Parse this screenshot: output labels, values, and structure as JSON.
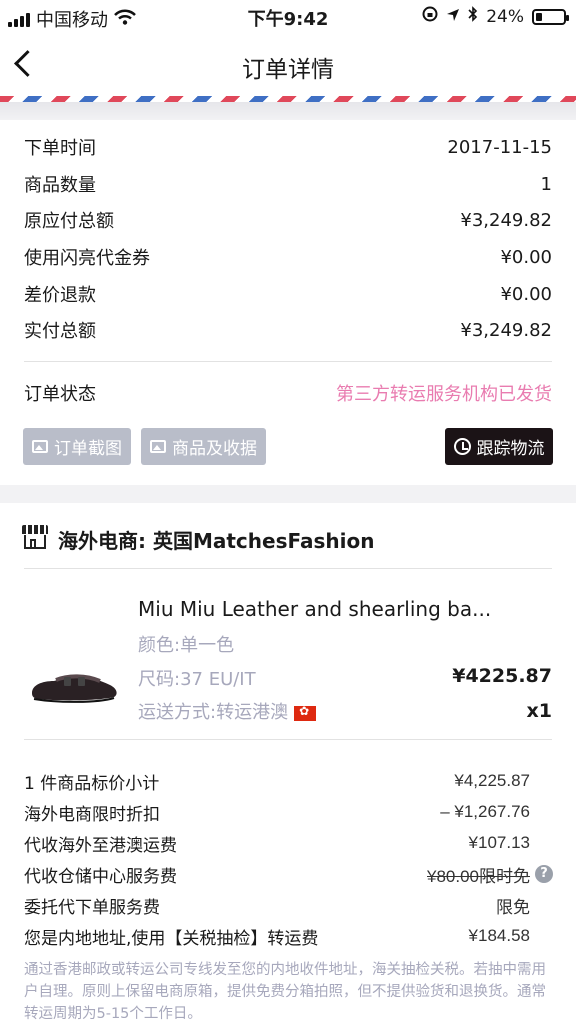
{
  "status_bar": {
    "carrier": "中国移动",
    "time": "下午9:42",
    "battery": "24%",
    "battery_level": 0.24
  },
  "nav": {
    "title": "订单详情"
  },
  "order": {
    "rows": [
      {
        "label": "下单时间",
        "value": "2017-11-15"
      },
      {
        "label": "商品数量",
        "value": "1"
      },
      {
        "label": "原应付总额",
        "value": "¥3,249.82"
      },
      {
        "label": "使用闪亮代金券",
        "value": "¥0.00"
      },
      {
        "label": "差价退款",
        "value": "¥0.00"
      },
      {
        "label": "实付总额",
        "value": "¥3,249.82"
      }
    ],
    "status_label": "订单状态",
    "status_value": "第三方转运服务机构已发货",
    "btn_screenshot": "订单截图",
    "btn_goods": "商品及收据",
    "btn_track": "跟踪物流"
  },
  "store": {
    "name": "海外电商: 英国MatchesFashion"
  },
  "product": {
    "title": "Miu Miu Leather and shearling ba...",
    "color": "颜色:单一色",
    "size": "尺码:37 EU/IT",
    "shipping": "运送方式:转运港澳",
    "price": "¥4225.87",
    "qty": "x1"
  },
  "fees": [
    {
      "label": "1 件商品标价小计",
      "value": "¥4,225.87"
    },
    {
      "label": "海外电商限时折扣",
      "value": "– ¥1,267.76"
    },
    {
      "label": "代收海外至港澳运费",
      "value": "¥107.13"
    },
    {
      "label": "代收仓储中心服务费",
      "value": "¥80.00限时免"
    },
    {
      "label": "委托代下单服务费",
      "value": "限免"
    },
    {
      "label": "您是内地地址,使用【关税抽检】转运费",
      "value": "¥184.58"
    }
  ],
  "note": "通过香港邮政或转运公司专线发至您的内地收件地址，海关抽检关税。若抽中需用户自理。原则上保留电商原箱，提供免费分箱拍照，但不提供验货和退换货。通常转运周期为5-15个工作日。",
  "colors": {
    "accent_pink": "#e97cb0",
    "button_gray": "#b9bdc9",
    "button_dark": "#1b1316",
    "muted": "#a7a8bc"
  }
}
